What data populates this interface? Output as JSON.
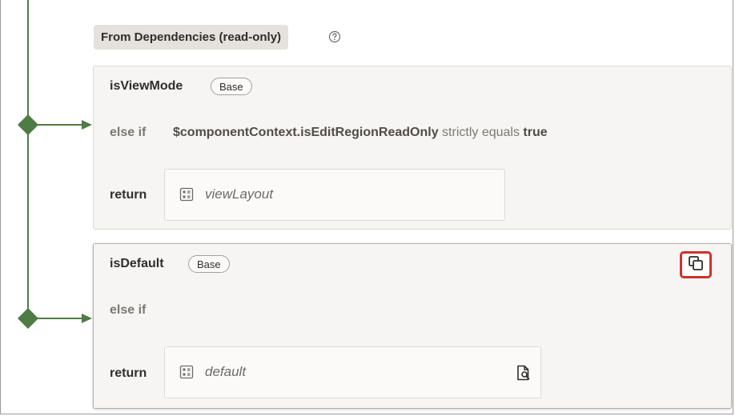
{
  "section": {
    "title": "From Dependencies (read-only)",
    "help_icon": "question-circle-icon"
  },
  "cases": [
    {
      "name": "isViewMode",
      "badge": "Base",
      "condition_label": "else if",
      "condition": {
        "variable": "$componentContext.isEditRegionReadOnly",
        "operator": "strictly equals",
        "value": "true"
      },
      "return_label": "return",
      "return_value": "viewLayout",
      "return_icon": "layout-grid-icon"
    },
    {
      "name": "isDefault",
      "badge": "Base",
      "condition_label": "else if",
      "return_label": "return",
      "return_value": "default",
      "return_icon": "layout-grid-icon",
      "action_icon": "duplicate-icon",
      "open_icon": "open-layout-icon"
    }
  ],
  "colors": {
    "flow_line": "#4f7b45",
    "highlight": "#d0312d",
    "card_bg": "#f6f5f3"
  }
}
